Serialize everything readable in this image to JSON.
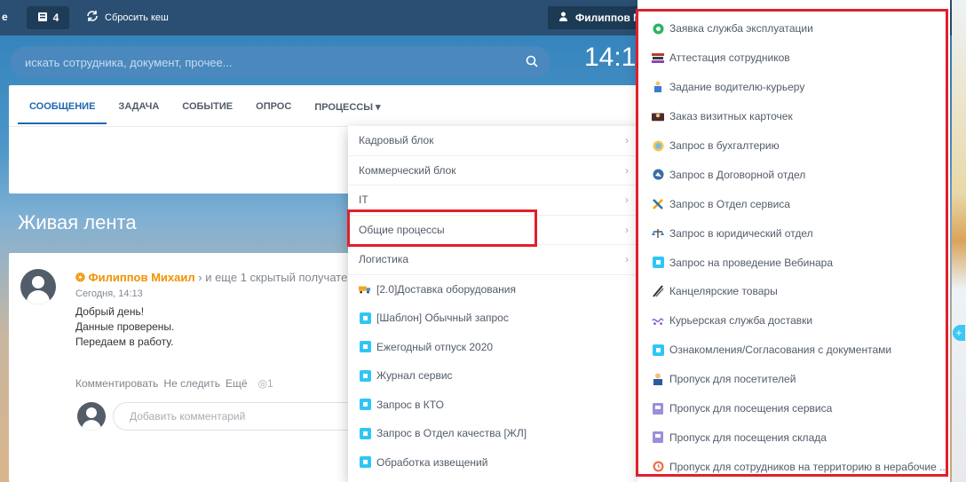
{
  "topbar": {
    "left_fragment": "e",
    "badge_count": "4",
    "cache_label": "Сбросить кеш",
    "user_name": "Филиппов Ми"
  },
  "search": {
    "placeholder": "искать сотрудника, документ, прочее..."
  },
  "clock": "14:1",
  "composer": {
    "tabs": [
      {
        "label": "СООБЩЕНИЕ",
        "active": true
      },
      {
        "label": "ЗАДАЧА"
      },
      {
        "label": "СОБЫТИЕ"
      },
      {
        "label": "ОПРОС"
      },
      {
        "label": "ПРОЦЕССЫ ▾"
      }
    ]
  },
  "feed_title": "Живая лента",
  "post": {
    "author": "Филиппов Михаил",
    "recipients": "› и еще 1 скрытый получате",
    "time": "Сегодня, 14:13",
    "lines": [
      "Добрый день!",
      "Данные проверены.",
      "Передаем в работу."
    ],
    "actions": [
      "Комментировать",
      "Не следить",
      "Ещё",
      "◎1"
    ],
    "comment_placeholder": "Добавить комментарий"
  },
  "menu1": {
    "groups": [
      {
        "label": "Кадровый блок",
        "arrow": "›"
      },
      {
        "label": "Коммерческий блок",
        "arrow": "›"
      },
      {
        "label": "IT",
        "arrow": "›"
      },
      {
        "label": "Общие процессы",
        "arrow": "›"
      },
      {
        "label": "Логистика",
        "arrow": "›"
      }
    ],
    "items": [
      {
        "label": "[2.0]Доставка оборудования",
        "icon": "truck-icon"
      },
      {
        "label": "[Шаблон] Обычный запрос",
        "icon": "process-icon"
      },
      {
        "label": "Ежегодный отпуск 2020",
        "icon": "process-icon"
      },
      {
        "label": "Журнал сервис",
        "icon": "process-icon"
      },
      {
        "label": "Запрос в КТО",
        "icon": "process-icon"
      },
      {
        "label": "Запрос в Отдел качества [ЖЛ]",
        "icon": "process-icon"
      },
      {
        "label": "Обработка извещений",
        "icon": "process-icon"
      }
    ]
  },
  "menu2": {
    "items": [
      {
        "label": "Заявка служба эксплуатации",
        "icon": "gear-green-icon"
      },
      {
        "label": "Аттестация сотрудников",
        "icon": "books-icon"
      },
      {
        "label": "Задание водителю-курьеру",
        "icon": "courier-icon"
      },
      {
        "label": "Заказ визитных карточек",
        "icon": "business-card-icon"
      },
      {
        "label": "Запрос в бухгалтерию",
        "icon": "accounting-icon"
      },
      {
        "label": "Запрос в Договорной отдел",
        "icon": "contract-icon"
      },
      {
        "label": "Запрос в Отдел сервиса",
        "icon": "tools-icon"
      },
      {
        "label": "Запрос в юридический отдел",
        "icon": "scales-icon"
      },
      {
        "label": "Запрос на проведение Вебинара",
        "icon": "process-icon"
      },
      {
        "label": "Канцелярские товары",
        "icon": "pencil-icon"
      },
      {
        "label": "Курьерская служба доставки",
        "icon": "delivery-icon"
      },
      {
        "label": "Ознакомления/Согласования с документами",
        "icon": "process-icon"
      },
      {
        "label": "Пропуск для посетителей",
        "icon": "visitor-icon"
      },
      {
        "label": "Пропуск для посещения сервиса",
        "icon": "pass-icon"
      },
      {
        "label": "Пропуск для посещения склада",
        "icon": "pass-icon"
      },
      {
        "label": "Пропуск для сотрудников на территорию в нерабочие ...",
        "icon": "clock-icon"
      }
    ]
  },
  "colors": {
    "accent": "#2067b0",
    "highlight": "#e0202d",
    "author": "#f29200"
  }
}
